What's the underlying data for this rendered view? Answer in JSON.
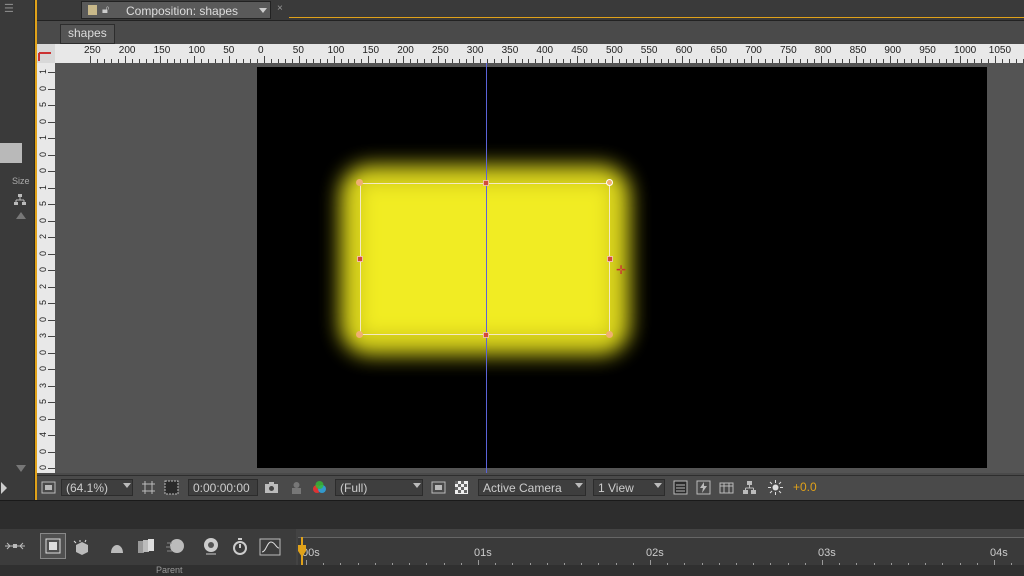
{
  "composition_tab": {
    "title": "Composition: shapes",
    "close": "×"
  },
  "comp_name_tab": "shapes",
  "left_panel": {
    "menu": "☰",
    "size_label": "Size"
  },
  "ruler_h": [
    "250",
    "200",
    "150",
    "100",
    "50",
    "0",
    "50",
    "100",
    "150",
    "200",
    "250",
    "300",
    "350",
    "400",
    "450",
    "500",
    "550",
    "600",
    "650",
    "700",
    "750",
    "800",
    "850",
    "900",
    "950",
    "1000",
    "1050"
  ],
  "ruler_v": [
    "1",
    "0",
    "5",
    "0",
    "1",
    "0",
    "0",
    "1",
    "5",
    "0",
    "2",
    "0",
    "0",
    "2",
    "5",
    "0",
    "3",
    "0",
    "0",
    "3",
    "5",
    "0",
    "4",
    "0",
    "0"
  ],
  "viewer_toolbar": {
    "magnification": "(64.1%)",
    "timecode": "0:00:00:00",
    "resolution": "(Full)",
    "camera": "Active Camera",
    "views": "1 View",
    "exposure": "+0.0"
  },
  "timeline": {
    "time_labels": [
      "00s",
      "01s",
      "02s",
      "03s",
      "04s"
    ],
    "layer_label": "Parent"
  },
  "colors": {
    "accent": "#e0a21a",
    "shape_fill": "#f1ec23",
    "guide": "#5b63d8",
    "canvas": "#000000"
  }
}
